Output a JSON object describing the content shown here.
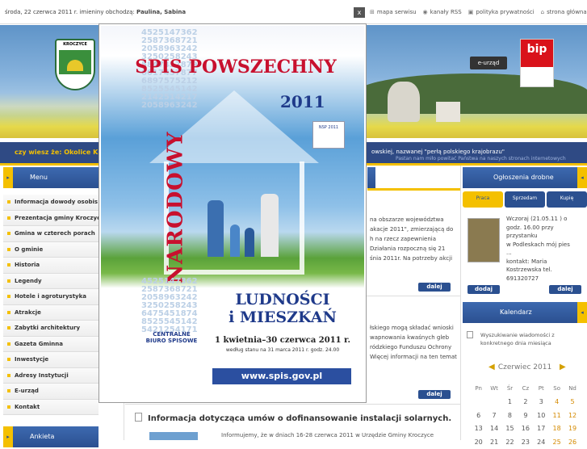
{
  "topbar": {
    "date_text": "środa, 22 czerwca 2011 r. imieniny obchodzą:",
    "names": "Paulina, Sabina",
    "close_label": "x",
    "links": [
      {
        "icon": "sitemap-icon",
        "label": "mapa serwisu"
      },
      {
        "icon": "rss-icon",
        "label": "kanały RSS"
      },
      {
        "icon": "privacy-icon",
        "label": "polityka prywatności"
      },
      {
        "icon": "home-icon",
        "label": "strona główna"
      }
    ]
  },
  "banner": {
    "crest_label": "KROCZYCE",
    "eurzad_label": "e-urząd",
    "bip_label": "bip"
  },
  "ticker": {
    "label": "czy wiesz że: Okolice K",
    "text": "owskiej, nazwanej \"perłą polskiego krajobrazu\"",
    "subtext": "Pastan nam miło powitać Państwa na naszych stronach internetowych"
  },
  "menu": {
    "title": "Menu",
    "items": [
      "Informacja dowody osobis",
      "Prezentacja gminy Kroczyc",
      "Gmina w czterech porach",
      "O gminie",
      "Historia",
      "Legendy",
      "Hotele i agroturystyka",
      "Atrakcje",
      "Zabytki architektury",
      "Gazeta Gminna",
      "Inwestycje",
      "Adresy Instytucji",
      "E-urząd",
      "Kontakt"
    ],
    "poll_title": "Ankieta"
  },
  "main": {
    "snippet1": [
      "na obszarze województwa",
      "akacje 2011\", zmierzającą do",
      "h na rzecz zapewnienia",
      "Działania rozpoczną się 21",
      "śnia 2011r. Na potrzeby akcji"
    ],
    "snippet2": [
      "łskiego mogą składać wnioski",
      "wapnowania kwaśnych gleb",
      "ródzkiego Funduszu Ochrony",
      "Więcej informacji na ten temat"
    ],
    "more_label": "dalej",
    "article_title": "Informacja dotycząca umów o dofinansowanie instalacji solarnych.",
    "article_text": "Informujemy, że w dniach 16-28 czerwca 2011 w Urzędzie Gminy Kroczyce"
  },
  "ads": {
    "title": "Ogłoszenia drobne",
    "tabs": [
      "Praca",
      "Sprzedam",
      "Kupię"
    ],
    "ad_text": [
      "Wczoraj (21.05.11 ) o",
      "godz. 16.00 przy",
      "przystanku",
      "w Podleskach mój pies",
      "...",
      "kontakt: Maria",
      "Kostrzewska tel.",
      "691320727"
    ],
    "add_label": "dodaj",
    "more_label": "dalej"
  },
  "calendar": {
    "title": "Kalendarz",
    "search_text": [
      "Wyszukiwanie wiadomości z",
      "konkretnego dnia miesiąca"
    ],
    "month": "Czerwiec 2011",
    "prev": "◀",
    "next": "▶",
    "weekdays": [
      "Pn",
      "Wt",
      "Śr",
      "Cz",
      "Pt",
      "So",
      "Nd"
    ],
    "weeks": [
      [
        "",
        "",
        "1",
        "2",
        "3",
        "4",
        "5"
      ],
      [
        "6",
        "7",
        "8",
        "9",
        "10",
        "11",
        "12"
      ],
      [
        "13",
        "14",
        "15",
        "16",
        "17",
        "18",
        "19"
      ],
      [
        "20",
        "21",
        "22",
        "23",
        "24",
        "25",
        "26"
      ]
    ]
  },
  "poster": {
    "title": "SPIS POWSZECHNY",
    "year": "2011",
    "vertical": "NARODOWY",
    "headline_1": "LUDNOŚCI",
    "headline_2": "i MIESZKAŃ",
    "dates": "1 kwietnia–30 czerwca 2011 r.",
    "dates_note": "według stanu na 31 marca 2011 r. godz. 24.00",
    "url": "www.spis.gov.pl",
    "cbs_1": "CENTRALNE",
    "cbs_2": "BIURO SPISOWE",
    "stamp": "NSP 2011",
    "numbers_top": "4525147362\n2587368721\n2058963242\n3250258243\n5847457879\n6017457877\n6897575212\n8525545142\n2142514217\n2058963242",
    "numbers_bottom": "4525147362\n2587368721\n2058963242\n3250258243\n6475451874\n8525545142\n5421254171"
  }
}
